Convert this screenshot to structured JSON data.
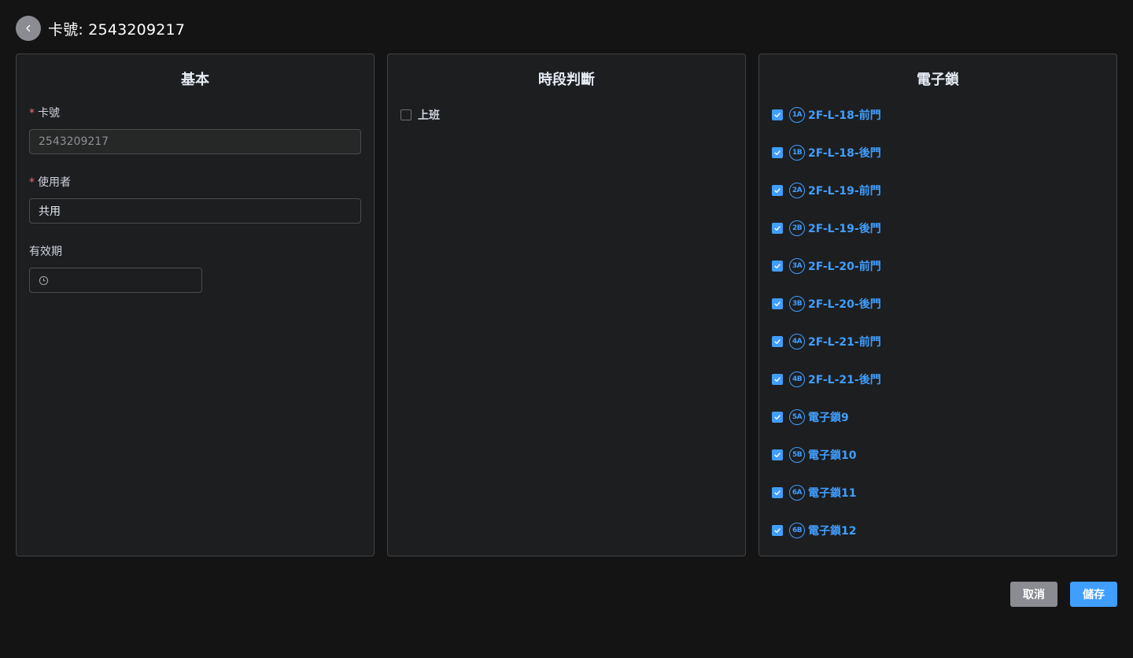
{
  "header": {
    "title": "卡號: 2543209217"
  },
  "basic": {
    "title": "基本",
    "card_label": "卡號",
    "card_value": "2543209217",
    "user_label": "使用者",
    "user_value": "共用",
    "validity_label": "有效期",
    "validity_value": ""
  },
  "time": {
    "title": "時段判斷",
    "items": [
      {
        "label": "上班",
        "checked": false
      }
    ]
  },
  "locks": {
    "title": "電子鎖",
    "items": [
      {
        "badge": "1A",
        "label": "2F-L-18-前門",
        "checked": true
      },
      {
        "badge": "1B",
        "label": "2F-L-18-後門",
        "checked": true
      },
      {
        "badge": "2A",
        "label": "2F-L-19-前門",
        "checked": true
      },
      {
        "badge": "2B",
        "label": "2F-L-19-後門",
        "checked": true
      },
      {
        "badge": "3A",
        "label": "2F-L-20-前門",
        "checked": true
      },
      {
        "badge": "3B",
        "label": "2F-L-20-後門",
        "checked": true
      },
      {
        "badge": "4A",
        "label": "2F-L-21-前門",
        "checked": true
      },
      {
        "badge": "4B",
        "label": "2F-L-21-後門",
        "checked": true
      },
      {
        "badge": "5A",
        "label": "電子鎖9",
        "checked": true
      },
      {
        "badge": "5B",
        "label": "電子鎖10",
        "checked": true
      },
      {
        "badge": "6A",
        "label": "電子鎖11",
        "checked": true
      },
      {
        "badge": "6B",
        "label": "電子鎖12",
        "checked": true
      }
    ]
  },
  "actions": {
    "cancel_label": "取消",
    "save_label": "儲存"
  },
  "colors": {
    "accent": "#409eff",
    "background": "#141415",
    "panel": "#1d1e20",
    "required": "#f56c6c"
  },
  "icons": {
    "back": "chevron-left-icon",
    "date": "clock-icon",
    "check": "check-icon"
  }
}
